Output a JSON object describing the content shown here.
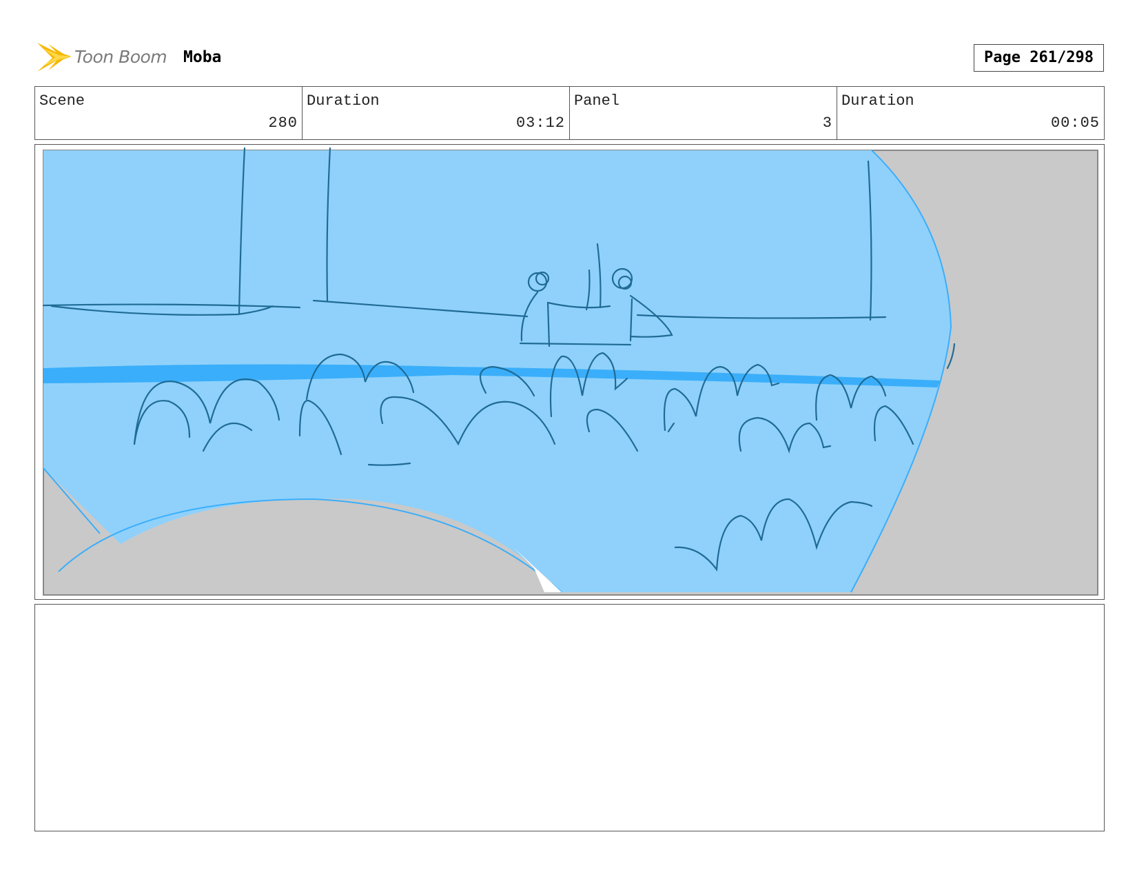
{
  "header": {
    "logo_text": "Toon Boom",
    "project": "Moba",
    "page": "Page 261/298"
  },
  "info": {
    "scene_label": "Scene",
    "scene_value": "280",
    "scene_duration_label": "Duration",
    "scene_duration_value": "03:12",
    "panel_label": "Panel",
    "panel_value": "3",
    "panel_duration_label": "Duration",
    "panel_duration_value": "00:05"
  },
  "colors": {
    "sky_blue": "#8fd1fb",
    "band_blue": "#3aaefa",
    "ink": "#1f6b96",
    "gray_fill": "#c9c9c9",
    "logo_yellow": "#f5b800"
  },
  "notes": {
    "text": ""
  }
}
